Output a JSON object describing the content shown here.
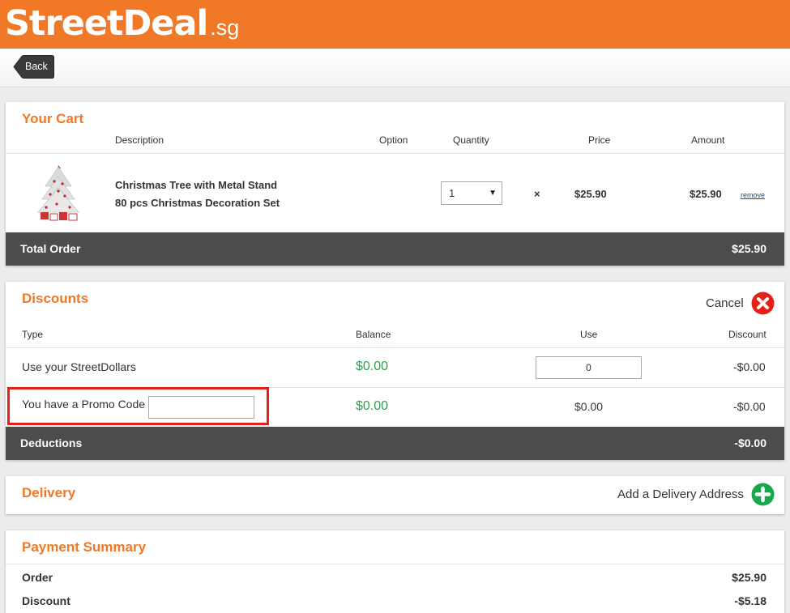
{
  "header": {
    "logo_main": "StreetDeal",
    "logo_tld": ".sg",
    "brand_color": "#f07826"
  },
  "nav": {
    "back_label": "Back"
  },
  "cart": {
    "title": "Your Cart",
    "columns": {
      "description": "Description",
      "option": "Option",
      "quantity": "Quantity",
      "price": "Price",
      "amount": "Amount"
    },
    "items": [
      {
        "name_line1": "Christmas Tree with Metal Stand",
        "name_line2": "80 pcs Christmas Decoration Set",
        "quantity": "1",
        "times": "×",
        "price": "$25.90",
        "amount": "$25.90",
        "remove_label": "remove",
        "image_icon": "christmas-tree-icon"
      }
    ],
    "total_label": "Total Order",
    "total_value": "$25.90"
  },
  "discounts": {
    "title": "Discounts",
    "cancel_label": "Cancel",
    "columns": {
      "type": "Type",
      "balance": "Balance",
      "use": "Use",
      "discount": "Discount"
    },
    "rows": [
      {
        "type": "Use your StreetDollars",
        "balance": "$0.00",
        "use": "0",
        "discount": "-$0.00"
      },
      {
        "type": "You have a Promo Code",
        "balance": "$0.00",
        "use": "$0.00",
        "discount": "-$0.00",
        "code_value": ""
      }
    ],
    "deductions_label": "Deductions",
    "deductions_value": "-$0.00"
  },
  "delivery": {
    "title": "Delivery",
    "add_label": "Add a Delivery Address"
  },
  "payment": {
    "title": "Payment Summary",
    "rows": [
      {
        "label": "Order",
        "value": "$25.90"
      },
      {
        "label": "Discount",
        "value": "-$5.18"
      }
    ]
  },
  "colors": {
    "accent": "#f07826",
    "dark_bar": "#4c4c4c",
    "balance_green": "#2ca24c",
    "cancel_red": "#e32119",
    "add_green": "#16a84a"
  }
}
